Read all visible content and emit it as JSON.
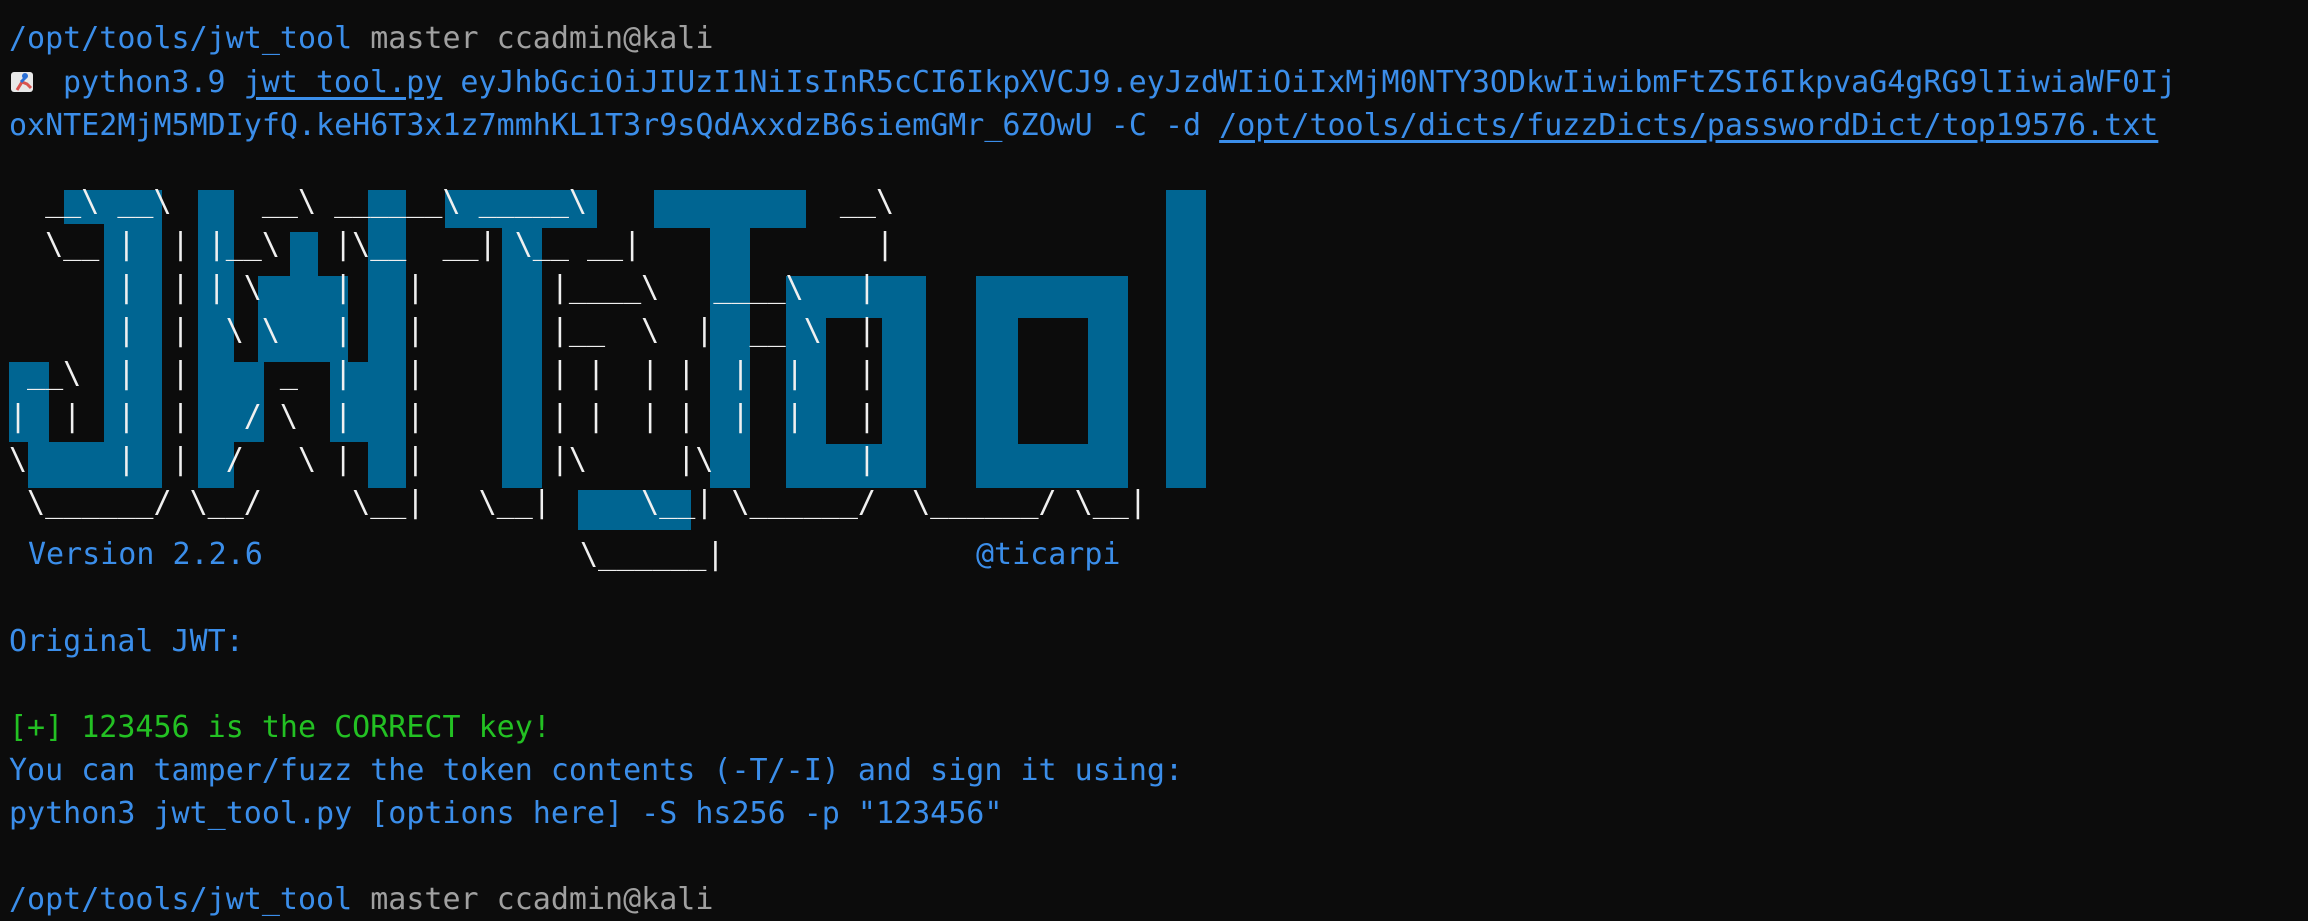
{
  "prompt": {
    "path": "/opt/tools/jwt_tool",
    "branch": "master",
    "user_host": "ccadmin@kali"
  },
  "command": {
    "icon": "running-person-icon",
    "interpreter": "python3.9",
    "script": "jwt_tool.py",
    "token_part1": "eyJhbGciOiJIUzI1NiIsInR5cCI6IkpXVCJ9.eyJzdWIiOiIxMjM0NTY3ODkwIiwibmFtZSI6IkpvaG4gRG9lIiwiaWF0Ij",
    "token_part2": "oxNTE2MjM5MDIyfQ.keH6T3x1z7mmhKL1T3r9sQdAxxdzB6siemGMr_6ZOwU",
    "flags": "-C -d",
    "wordlist": "/opt/tools/dicts/fuzzDicts/passwordDict/top19576.txt"
  },
  "banner": {
    "ascii_art": "  __\\ __\\     __\\ ______\\ _____\\              __\\\n  \\__ |  | |__\\   |\\__  __| \\__ __|             |\n      |  | | \\    |   |       |____\\   ____\\   |\n      |  |  \\ \\   |   |       |__  \\  |  __ \\  |\n __\\  |  |     _  |   |       | |  | |  |  |   |\n|  |  |  |   / \\  |   |       | |  | |  |  |   |\n\\     |  |  /   \\ |   |       |\\     |\\        |\n \\______/ \\__/     \\__|   \\__|     \\__| \\______/  \\______/ \\__|",
    "version": "Version 2.2.6",
    "underline_art": "\\______|",
    "author": "@ticarpi"
  },
  "output": {
    "original_label": "Original JWT:",
    "success": "[+] 123456 is the CORRECT key!",
    "hint": "You can tamper/fuzz the token contents (-T/-I) and sign it using:",
    "suggested_command": "python3 jwt_tool.py [options here] -S hs256 -p \"123456\""
  },
  "colors": {
    "background": "#0c0c0c",
    "prompt_blue": "#3b8eea",
    "block_blue": "#006592",
    "success_green": "#23c123",
    "muted_gray": "#a0a0a0"
  }
}
